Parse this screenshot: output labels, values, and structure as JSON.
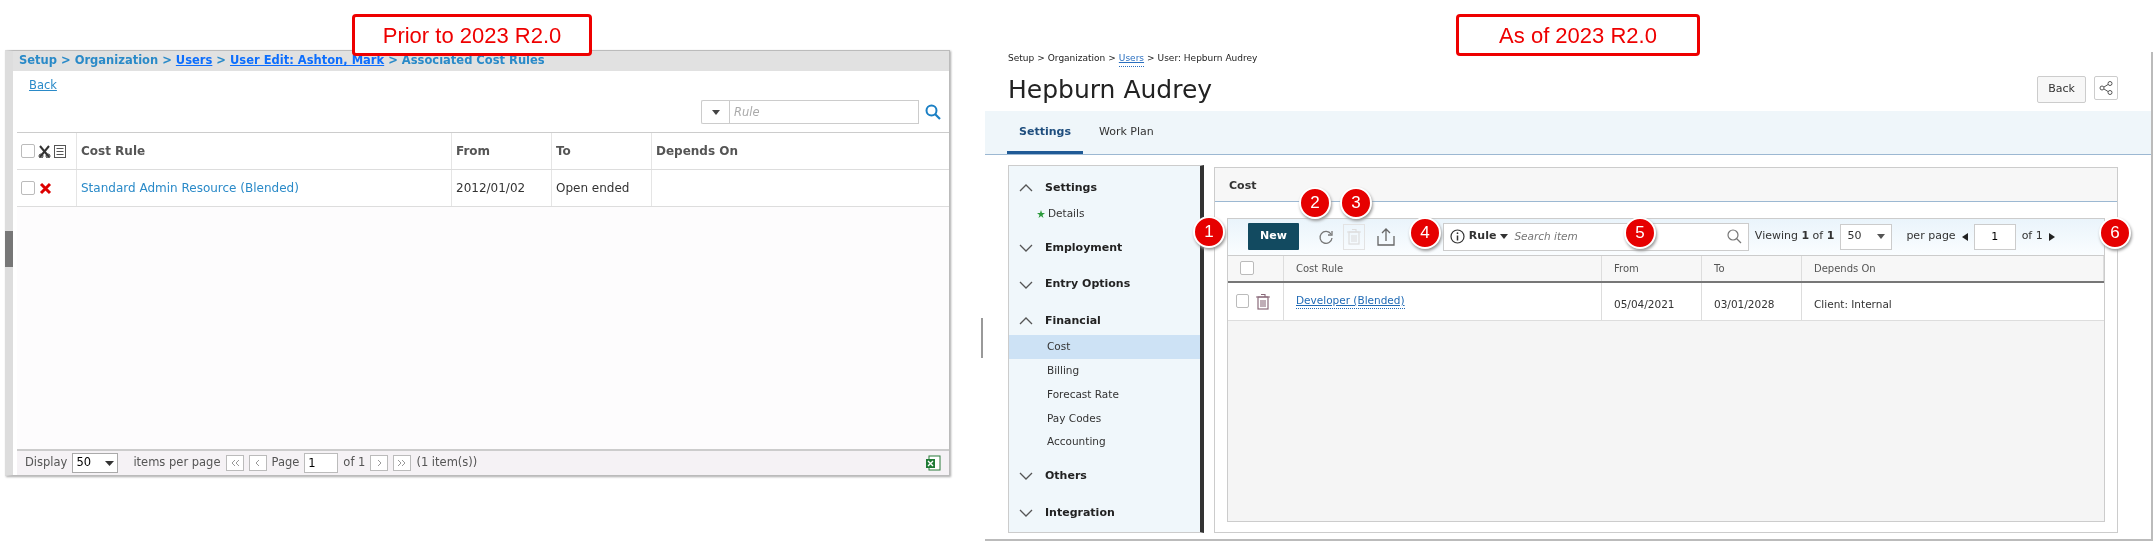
{
  "captions": [
    {
      "text": "Prior to 2023 R2.0"
    },
    {
      "text": "As of 2023 R2.0"
    }
  ],
  "old_screen": {
    "breadcrumb": {
      "separator": ">",
      "items": [
        {
          "text": "Setup",
          "underlined": false
        },
        {
          "text": "Organization",
          "underlined": false
        },
        {
          "text": "Users",
          "underlined": true
        },
        {
          "text": "User Edit: Ashton, Mark",
          "underlined": true
        },
        {
          "text": "Associated Cost Rules",
          "underlined": false
        }
      ]
    },
    "back": "Back",
    "search": {
      "placeholder": "Rule"
    },
    "table": {
      "all_checked": false,
      "columns": [
        "Cost Rule",
        "From",
        "To",
        "Depends On"
      ],
      "rows": [
        {
          "rule": "Standard Admin Resource (Blended)",
          "from": "2012/01/02",
          "to": "Open ended",
          "checked": false
        }
      ]
    },
    "footer": {
      "display": "Display",
      "per_page": "50",
      "items_per_page": "items per page",
      "page_label": "Page",
      "page": "1",
      "of": "of 1",
      "count": "(1 item(s))"
    }
  },
  "new_screen": {
    "breadcrumb": {
      "separator": ">",
      "items": [
        {
          "text": "Setup",
          "underlined": false
        },
        {
          "text": "Organization",
          "underlined": false
        },
        {
          "text": "Users",
          "underlined": true
        },
        {
          "text": "User: Hepburn Audrey",
          "underlined": false
        }
      ]
    },
    "title": "Hepburn Audrey",
    "back": "Back",
    "tabs": [
      {
        "label": "Settings",
        "selected": true
      },
      {
        "label": "Work Plan",
        "selected": false
      }
    ],
    "sidebar": {
      "groups": [
        {
          "label": "Settings",
          "expanded": true,
          "children": [
            {
              "label": "Details",
              "selected": false,
              "starred": true
            }
          ]
        },
        {
          "label": "Employment",
          "expanded": false
        },
        {
          "label": "Entry Options",
          "expanded": false
        },
        {
          "label": "Financial",
          "expanded": true,
          "children": [
            {
              "label": "Cost",
              "selected": true,
              "starred": false
            },
            {
              "label": "Billing",
              "selected": false,
              "starred": false
            },
            {
              "label": "Forecast Rate",
              "selected": false,
              "starred": false
            },
            {
              "label": "Pay Codes",
              "selected": false,
              "starred": false
            },
            {
              "label": "Accounting",
              "selected": false,
              "starred": false
            }
          ]
        },
        {
          "label": "Others",
          "expanded": false
        },
        {
          "label": "Integration",
          "expanded": false
        }
      ]
    },
    "panel_title": "Cost",
    "toolbar": {
      "new": "New",
      "filter": "Rule",
      "placeholder": "Search item",
      "viewing": "Viewing **1** of **1**",
      "per_page": "50",
      "per_page_label": "per page",
      "page": "1",
      "of": "of 1"
    },
    "grid": {
      "all_checked": false,
      "columns": [
        "Cost Rule",
        "From",
        "To",
        "Depends On"
      ],
      "rows": [
        {
          "rule": "Developer (Blended)",
          "from": "05/04/2021",
          "to": "03/01/2028",
          "depends_on": "Client: Internal",
          "checked": false
        }
      ]
    },
    "callouts": [
      "1",
      "2",
      "3",
      "4",
      "5",
      "6"
    ]
  }
}
